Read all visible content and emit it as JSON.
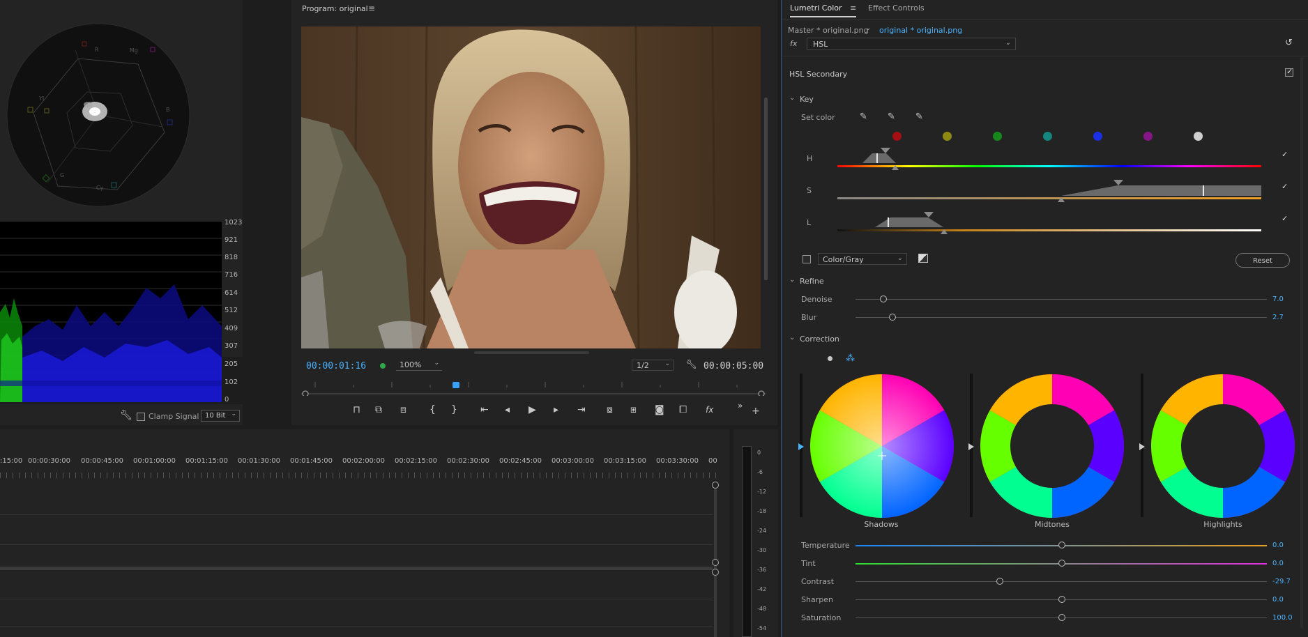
{
  "program": {
    "title": "Program: original",
    "timecode": "00:00:01:16",
    "zoom": "100%",
    "resolution": "1/2",
    "duration": "00:00:05:00",
    "playhead_fraction": 0.33
  },
  "scopes": {
    "waveform_scale": [
      "1023",
      "921",
      "818",
      "716",
      "614",
      "512",
      "409",
      "307",
      "205",
      "102",
      "0"
    ],
    "vector_labels": [
      "R",
      "Mg",
      "B",
      "Cy",
      "G",
      "YI"
    ],
    "clamp_signal_label": "Clamp Signal",
    "bit_depth": "10 Bit"
  },
  "timeline": {
    "ruler": [
      ":15:00",
      "00:00:30:00",
      "00:00:45:00",
      "00:01:00:00",
      "00:01:15:00",
      "00:01:30:00",
      "00:01:45:00",
      "00:02:00:00",
      "00:02:15:00",
      "00:02:30:00",
      "00:02:45:00",
      "00:03:00:00",
      "00:03:15:00",
      "00:03:30:00",
      "00"
    ],
    "db_scale": [
      "0",
      "-6",
      "-12",
      "-18",
      "-24",
      "-30",
      "-36",
      "-42",
      "-48",
      "-54"
    ]
  },
  "lumetri": {
    "tab_active": "Lumetri Color",
    "tab_other": "Effect Controls",
    "master_clip": "Master * original.png",
    "active_clip": "original * original.png",
    "fx_label": "fx",
    "section_dropdown": "HSL",
    "hsl_secondary_title": "HSL Secondary",
    "key_title": "Key",
    "set_color_label": "Set color",
    "swatches": [
      "#a40f13",
      "#8d8a13",
      "#17871c",
      "#14857f",
      "#1a2fe6",
      "#851685",
      "#cfcfcf"
    ],
    "h_label": "H",
    "s_label": "S",
    "l_label": "L",
    "color_gray_label": "Color/Gray",
    "reset_label": "Reset",
    "refine_title": "Refine",
    "denoise_label": "Denoise",
    "denoise_value": "7.0",
    "blur_label": "Blur",
    "blur_value": "2.7",
    "correction_title": "Correction",
    "wheels": [
      "Shadows",
      "Midtones",
      "Highlights"
    ],
    "temperature_label": "Temperature",
    "temperature_value": "0.0",
    "tint_label": "Tint",
    "tint_value": "0.0",
    "contrast_label": "Contrast",
    "contrast_value": "-29.7",
    "sharpen_label": "Sharpen",
    "sharpen_value": "0.0",
    "saturation_label": "Saturation",
    "saturation_value": "100.0"
  }
}
